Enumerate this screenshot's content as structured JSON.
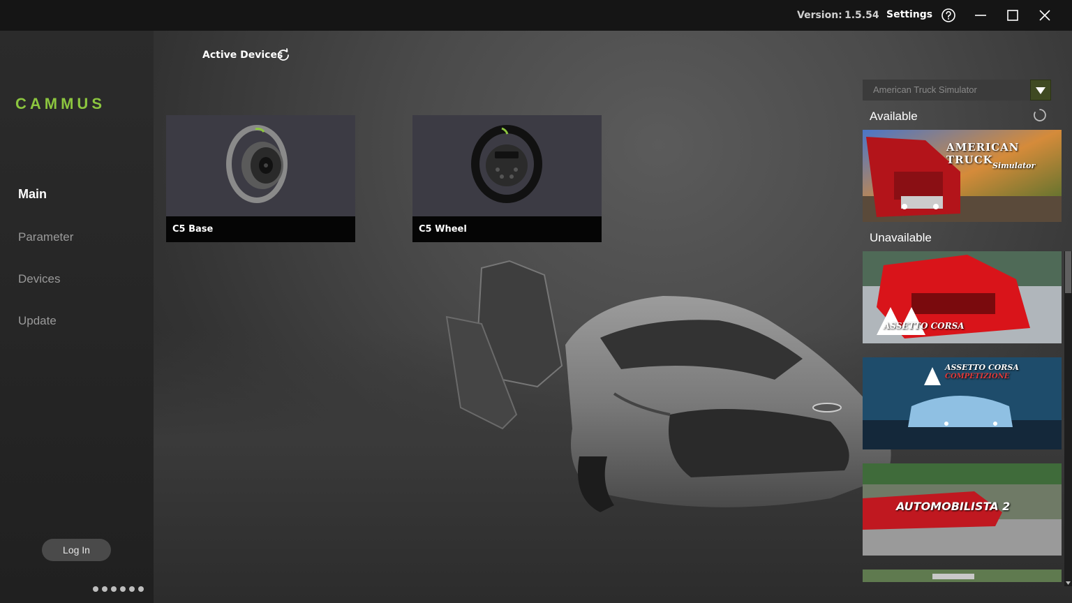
{
  "titlebar": {
    "version_label": "Version:",
    "version": "1.5.54",
    "settings": "Settings",
    "help_icon": "help-icon",
    "minimize_icon": "minimize-icon",
    "maximize_icon": "maximize-icon",
    "close_icon": "close-icon"
  },
  "sidebar": {
    "logo": "CAMMUS",
    "items": [
      {
        "label": "Main",
        "active": true
      },
      {
        "label": "Parameter",
        "active": false
      },
      {
        "label": "Devices",
        "active": false
      },
      {
        "label": "Update",
        "active": false
      }
    ],
    "login_label": "Log In",
    "page_dots": 6
  },
  "main": {
    "active_devices_label": "Active Devices",
    "devices": [
      {
        "name": "C5 Base",
        "icon": "wheel-base-icon"
      },
      {
        "name": "C5 Wheel",
        "icon": "steering-wheel-icon"
      }
    ]
  },
  "games": {
    "selected_game": "American Truck Simulator",
    "available_label": "Available",
    "unavailable_label": "Unavailable",
    "available": [
      {
        "title": "AMERICAN TRUCK",
        "subtitle": "Simulator"
      }
    ],
    "unavailable": [
      {
        "title": "ASSETTO CORSA"
      },
      {
        "title": "ASSETTO CORSA",
        "subtitle": "COMPETIZIONE"
      },
      {
        "title": "AUTOMOBILISTA 2"
      }
    ]
  },
  "colors": {
    "accent_green": "#8cc63f",
    "titlebar_bg": "#151515",
    "card_bg": "#3c3b44"
  }
}
